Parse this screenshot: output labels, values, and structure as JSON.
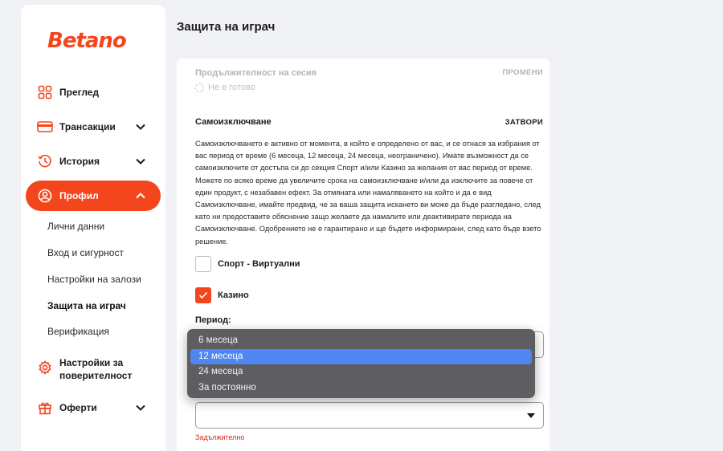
{
  "brand": {
    "name": "Betano",
    "color": "#f4461d"
  },
  "page_title": "Защита на играч",
  "sidebar": {
    "items": [
      {
        "label": "Преглед",
        "icon": "grid-icon",
        "expandable": false
      },
      {
        "label": "Трансакции",
        "icon": "credit-card-icon",
        "expandable": true
      },
      {
        "label": "История",
        "icon": "history-icon",
        "expandable": true
      },
      {
        "label": "Профил",
        "icon": "user-icon",
        "expandable": true,
        "active": true
      },
      {
        "label": "Настройки за поверителност",
        "icon": "gear-icon",
        "expandable": false
      },
      {
        "label": "Оферти",
        "icon": "gift-icon",
        "expandable": true
      }
    ],
    "profile_subitems": [
      {
        "label": "Лични данни"
      },
      {
        "label": "Вход и сигурност"
      },
      {
        "label": "Настройки на залози"
      },
      {
        "label": "Защита на играч",
        "current": true
      },
      {
        "label": "Верификация"
      }
    ]
  },
  "session": {
    "label": "Продължителност на сесия",
    "action": "ПРОМЕНИ",
    "status": "Не е готово"
  },
  "self_exclusion": {
    "title": "Самоизключване",
    "action": "ЗАТВОРИ",
    "description": "Самоизключването е активно от момента, в който е определено от вас, и се отнася за избрания от вас период от време (6 месеца, 12 месеца, 24 месеца, неограничено). Имате възможност да се самоизключите от достъпа си до секция Спорт и/или Казино за желания от вас период от време. Можете по всяко време да увеличите срока на самоизключване и/или да изключите за повече от един продукт, с незабавен ефект. За отмяната или намаляването на който и да е вид Самоизключване, имайте предвид, че за ваша защита искането ви може да бъде разгледано, след като ни предоставите обяснение защо желаете да намалите или деактивирате периода на Самоизключване. Одобрението не е гарантирано и ще бъдете информирани, след като бъде взето решение.",
    "options": [
      {
        "label": "Спорт - Виртуални",
        "checked": false
      },
      {
        "label": "Казино",
        "checked": true
      }
    ],
    "period_label": "Период:",
    "period_options": [
      "6 месеца",
      "12 месеца",
      "24 месеца",
      "За постоянно"
    ],
    "period_selected": "12 месеца",
    "second_select_value": "",
    "required_text": "Задължително"
  }
}
